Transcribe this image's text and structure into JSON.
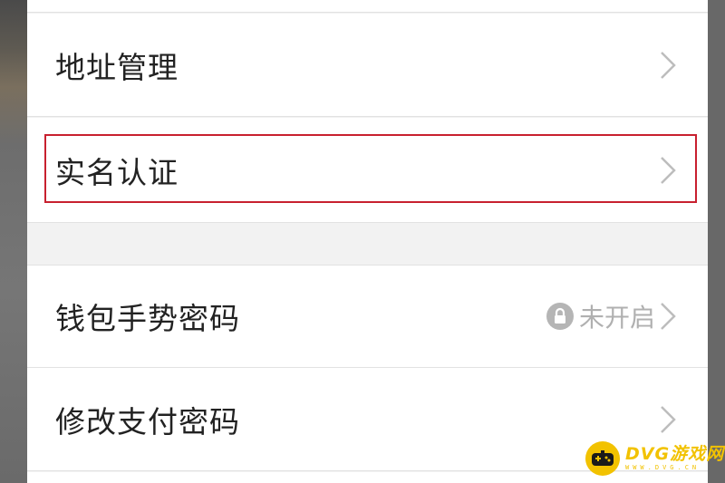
{
  "settings": {
    "rows": {
      "address": {
        "label": "地址管理"
      },
      "realname": {
        "label": "实名认证",
        "highlighted": true
      },
      "gesture": {
        "label": "钱包手势密码",
        "status": "未开启"
      },
      "paypwd": {
        "label": "修改支付密码"
      }
    }
  },
  "highlight": {
    "color": "#c8202f"
  },
  "icons": {
    "chevron": "chevron-right-icon",
    "lock": "lock-icon",
    "watermark_logo": "gamepad-icon"
  },
  "watermark": {
    "title": "DVG游戏网",
    "subtitle": "WWW.DVG.CN"
  }
}
